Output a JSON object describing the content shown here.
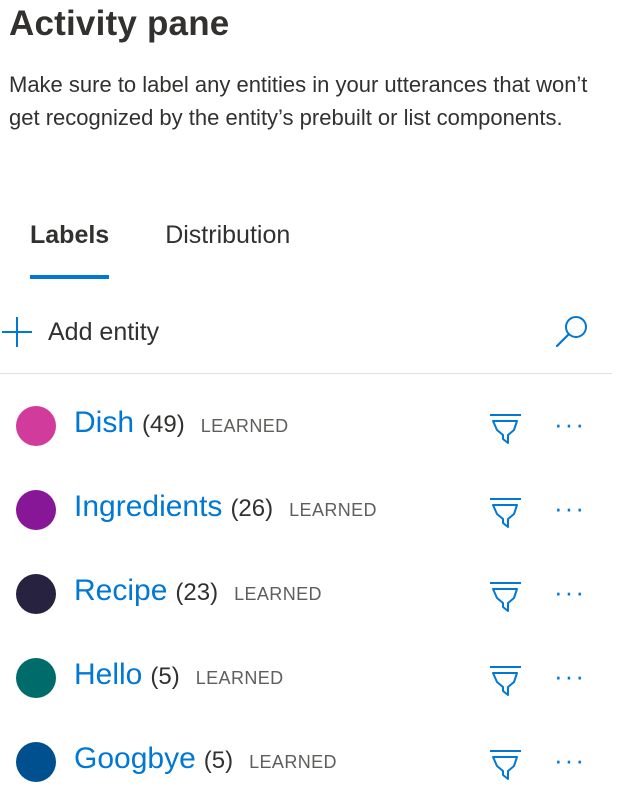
{
  "pane": {
    "title": "Activity pane",
    "description": "Make sure to label any entities in your utterances that won’t get recognized by the entity’s prebuilt or list components."
  },
  "tabs": [
    {
      "label": "Labels",
      "active": true
    },
    {
      "label": "Distribution",
      "active": false
    }
  ],
  "toolbar": {
    "add_label": "Add entity",
    "add_icon": "plus-icon",
    "search_icon": "search-icon"
  },
  "entities": [
    {
      "name": "Dish",
      "count": "(49)",
      "kind": "LEARNED",
      "color": "#d13b9c"
    },
    {
      "name": "Ingredients",
      "count": "(26)",
      "kind": "LEARNED",
      "color": "#881798"
    },
    {
      "name": "Recipe",
      "count": "(23)",
      "kind": "LEARNED",
      "color": "#272240"
    },
    {
      "name": "Hello",
      "count": "(5)",
      "kind": "LEARNED",
      "color": "#006b6b"
    },
    {
      "name": "Googbye",
      "count": "(5)",
      "kind": "LEARNED",
      "color": "#00508f"
    }
  ],
  "row_actions": {
    "label_icon": "highlighter-icon",
    "more_label": "···",
    "more_icon": "more-icon"
  },
  "colors": {
    "accent": "#0078d4",
    "text": "#323130",
    "muted": "#605e5c",
    "divider": "#e1dfdd"
  }
}
